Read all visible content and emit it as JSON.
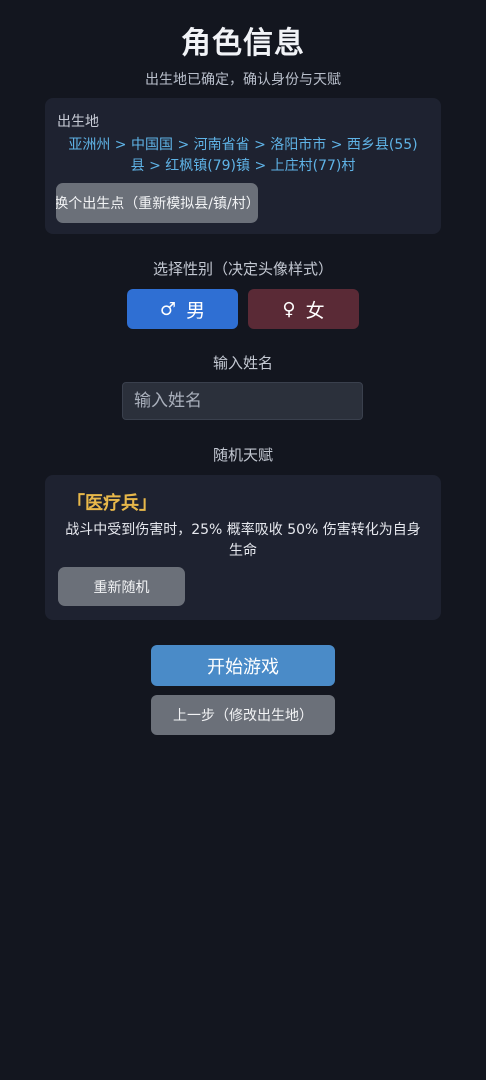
{
  "header": {
    "title": "角色信息",
    "subtitle": "出生地已确定，确认身份与天赋"
  },
  "birthplace": {
    "label": "出生地",
    "path_line1": "亚洲州 > 中国国 > 河南省省 > 洛阳市市 > 西乡县(55)",
    "path_line2": "县 > 红枫镇(79)镇 > 上庄村(77)村",
    "reroll_label": "换个出生点（重新模拟县/镇/村）"
  },
  "gender": {
    "label": "选择性别（决定头像样式）",
    "male": {
      "symbol": "♂",
      "label": "男",
      "color": "#2f6fd3"
    },
    "female": {
      "symbol": "♀",
      "label": "女",
      "color": "#5a2a36"
    }
  },
  "name": {
    "label": "输入姓名",
    "value": "",
    "placeholder": "输入姓名"
  },
  "talent": {
    "label": "随机天赋",
    "name": "「医疗兵」",
    "description": "战斗中受到伤害时，25% 概率吸收 50% 伤害转化为自身生命",
    "reroll_label": "重新随机"
  },
  "actions": {
    "start_label": "开始游戏",
    "back_label": "上一步（修改出生地）"
  },
  "colors": {
    "background": "#13161f",
    "card": "#1e2230",
    "accent_blue": "#4a8bc8",
    "path_link": "#5fb3e6",
    "talent_gold": "#e8b84a"
  }
}
